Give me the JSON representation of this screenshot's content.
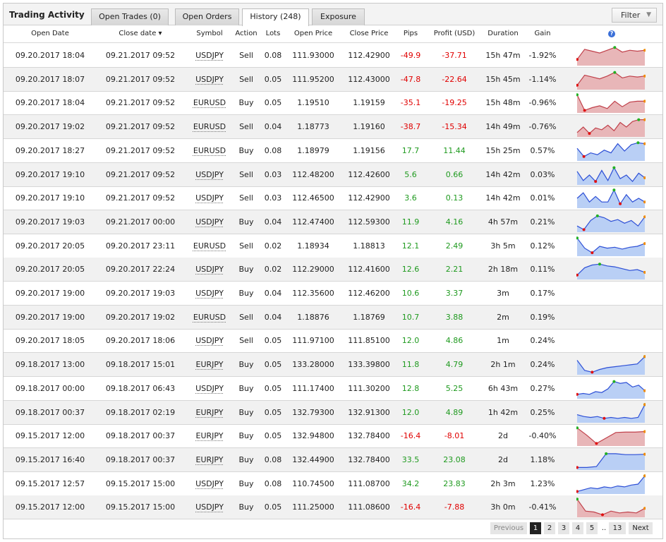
{
  "tabs": {
    "title": "Trading Activity",
    "items": [
      {
        "label": "Open Trades (0)",
        "active": false
      },
      {
        "label": "Open Orders",
        "active": false
      },
      {
        "label": "History (248)",
        "active": true
      },
      {
        "label": "Exposure",
        "active": false
      }
    ],
    "filter_label": "Filter",
    "filter_arrow": "▼"
  },
  "columns": {
    "open_date": "Open Date",
    "close_date": "Close date ▾",
    "symbol": "Symbol",
    "action": "Action",
    "lots": "Lots",
    "open_price": "Open Price",
    "close_price": "Close Price",
    "pips": "Pips",
    "profit": "Profit (USD)",
    "duration": "Duration",
    "gain": "Gain",
    "help": "?"
  },
  "colors": {
    "negative": "#e00000",
    "positive": "#1f9a1f",
    "spark_neg_fill": "#e8b6b8",
    "spark_neg_line": "#c0404a",
    "spark_pos_fill": "#b9cff5",
    "spark_pos_line": "#2d4fd6"
  },
  "rows": [
    {
      "open": "09.20.2017 18:04",
      "close": "09.21.2017 09:52",
      "symbol": "USDJPY",
      "action": "Sell",
      "lots": "0.08",
      "open_price": "111.93000",
      "close_price": "112.42900",
      "pips": "-49.9",
      "profit": "-37.71",
      "duration": "15h 47m",
      "gain": "-1.92%",
      "spark": [
        0.3,
        0.85,
        0.75,
        0.65,
        0.8,
        0.95,
        0.7,
        0.8,
        0.75,
        0.8
      ]
    },
    {
      "open": "09.20.2017 18:07",
      "close": "09.21.2017 09:52",
      "symbol": "USDJPY",
      "action": "Sell",
      "lots": "0.05",
      "open_price": "111.95200",
      "close_price": "112.43000",
      "pips": "-47.8",
      "profit": "-22.64",
      "duration": "15h 45m",
      "gain": "-1.14%",
      "spark": [
        0.2,
        0.75,
        0.65,
        0.55,
        0.7,
        0.9,
        0.6,
        0.7,
        0.65,
        0.7
      ]
    },
    {
      "open": "09.20.2017 18:04",
      "close": "09.21.2017 09:52",
      "symbol": "EURUSD",
      "action": "Buy",
      "lots": "0.05",
      "open_price": "1.19510",
      "close_price": "1.19159",
      "pips": "-35.1",
      "profit": "-19.25",
      "duration": "15h 48m",
      "gain": "-0.96%",
      "spark": [
        0.95,
        0.1,
        0.25,
        0.35,
        0.2,
        0.6,
        0.3,
        0.55,
        0.6,
        0.6
      ]
    },
    {
      "open": "09.20.2017 19:02",
      "close": "09.21.2017 09:52",
      "symbol": "EURUSD",
      "action": "Sell",
      "lots": "0.04",
      "open_price": "1.18773",
      "close_price": "1.19160",
      "pips": "-38.7",
      "profit": "-15.34",
      "duration": "14h 49m",
      "gain": "-0.76%",
      "spark": [
        0.2,
        0.5,
        0.15,
        0.45,
        0.35,
        0.6,
        0.3,
        0.75,
        0.5,
        0.8,
        0.9,
        0.9
      ]
    },
    {
      "open": "09.20.2017 18:27",
      "close": "09.21.2017 09:52",
      "symbol": "EURUSD",
      "action": "Buy",
      "lots": "0.08",
      "open_price": "1.18979",
      "close_price": "1.19156",
      "pips": "17.7",
      "profit": "11.44",
      "duration": "15h 25m",
      "gain": "0.57%",
      "spark": [
        0.65,
        0.2,
        0.4,
        0.3,
        0.55,
        0.4,
        0.9,
        0.5,
        0.85,
        0.95,
        0.9
      ]
    },
    {
      "open": "09.20.2017 19:10",
      "close": "09.21.2017 09:52",
      "symbol": "USDJPY",
      "action": "Sell",
      "lots": "0.03",
      "open_price": "112.48200",
      "close_price": "112.42600",
      "pips": "5.6",
      "profit": "0.66",
      "duration": "14h 42m",
      "gain": "0.03%",
      "spark": [
        0.7,
        0.2,
        0.5,
        0.15,
        0.75,
        0.2,
        0.9,
        0.3,
        0.5,
        0.15,
        0.6,
        0.35
      ]
    },
    {
      "open": "09.20.2017 19:10",
      "close": "09.21.2017 09:52",
      "symbol": "USDJPY",
      "action": "Sell",
      "lots": "0.03",
      "open_price": "112.46500",
      "close_price": "112.42900",
      "pips": "3.6",
      "profit": "0.13",
      "duration": "14h 42m",
      "gain": "0.01%",
      "spark": [
        0.5,
        0.8,
        0.3,
        0.6,
        0.3,
        0.3,
        0.95,
        0.2,
        0.7,
        0.3,
        0.5,
        0.3
      ]
    },
    {
      "open": "09.20.2017 19:03",
      "close": "09.21.2017 00:00",
      "symbol": "USDJPY",
      "action": "Buy",
      "lots": "0.04",
      "open_price": "112.47400",
      "close_price": "112.59300",
      "pips": "11.9",
      "profit": "4.16",
      "duration": "4h 57m",
      "gain": "0.21%",
      "spark": [
        0.3,
        0.1,
        0.6,
        0.85,
        0.75,
        0.55,
        0.65,
        0.45,
        0.6,
        0.3,
        0.8
      ]
    },
    {
      "open": "09.20.2017 20:05",
      "close": "09.20.2017 23:11",
      "symbol": "EURUSD",
      "action": "Sell",
      "lots": "0.02",
      "open_price": "1.18934",
      "close_price": "1.18813",
      "pips": "12.1",
      "profit": "2.49",
      "duration": "3h 5m",
      "gain": "0.12%",
      "spark": [
        0.95,
        0.4,
        0.15,
        0.5,
        0.4,
        0.45,
        0.35,
        0.45,
        0.5,
        0.65
      ]
    },
    {
      "open": "09.20.2017 20:05",
      "close": "09.20.2017 22:24",
      "symbol": "USDJPY",
      "action": "Buy",
      "lots": "0.02",
      "open_price": "112.29000",
      "close_price": "112.41600",
      "pips": "12.6",
      "profit": "2.21",
      "duration": "2h 18m",
      "gain": "0.11%",
      "spark": [
        0.2,
        0.6,
        0.75,
        0.8,
        0.7,
        0.65,
        0.55,
        0.45,
        0.5,
        0.35
      ]
    },
    {
      "open": "09.20.2017 19:00",
      "close": "09.20.2017 19:03",
      "symbol": "USDJPY",
      "action": "Buy",
      "lots": "0.04",
      "open_price": "112.35600",
      "close_price": "112.46200",
      "pips": "10.6",
      "profit": "3.37",
      "duration": "3m",
      "gain": "0.17%",
      "spark": null
    },
    {
      "open": "09.20.2017 19:00",
      "close": "09.20.2017 19:02",
      "symbol": "EURUSD",
      "action": "Sell",
      "lots": "0.04",
      "open_price": "1.18876",
      "close_price": "1.18769",
      "pips": "10.7",
      "profit": "3.88",
      "duration": "2m",
      "gain": "0.19%",
      "spark": null
    },
    {
      "open": "09.20.2017 18:05",
      "close": "09.20.2017 18:06",
      "symbol": "USDJPY",
      "action": "Sell",
      "lots": "0.05",
      "open_price": "111.97100",
      "close_price": "111.85100",
      "pips": "12.0",
      "profit": "4.86",
      "duration": "1m",
      "gain": "0.24%",
      "spark": null
    },
    {
      "open": "09.18.2017 13:00",
      "close": "09.18.2017 15:01",
      "symbol": "EURJPY",
      "action": "Buy",
      "lots": "0.05",
      "open_price": "133.28000",
      "close_price": "133.39800",
      "pips": "11.8",
      "profit": "4.79",
      "duration": "2h 1m",
      "gain": "0.24%",
      "spark": [
        0.75,
        0.2,
        0.1,
        0.25,
        0.35,
        0.4,
        0.45,
        0.5,
        0.55,
        0.95
      ]
    },
    {
      "open": "09.18.2017 00:00",
      "close": "09.18.2017 06:43",
      "symbol": "USDJPY",
      "action": "Buy",
      "lots": "0.05",
      "open_price": "111.17400",
      "close_price": "111.30200",
      "pips": "12.8",
      "profit": "5.25",
      "duration": "6h 43m",
      "gain": "0.27%",
      "spark": [
        0.2,
        0.25,
        0.2,
        0.35,
        0.3,
        0.5,
        0.9,
        0.8,
        0.85,
        0.6,
        0.7,
        0.4
      ]
    },
    {
      "open": "09.18.2017 00:37",
      "close": "09.18.2017 02:19",
      "symbol": "EURJPY",
      "action": "Buy",
      "lots": "0.05",
      "open_price": "132.79300",
      "close_price": "132.91300",
      "pips": "12.0",
      "profit": "4.89",
      "duration": "1h 42m",
      "gain": "0.25%",
      "spark": [
        0.4,
        0.3,
        0.25,
        0.3,
        0.2,
        0.25,
        0.2,
        0.25,
        0.2,
        0.25,
        0.95
      ]
    },
    {
      "open": "09.15.2017 12:00",
      "close": "09.18.2017 00:37",
      "symbol": "EURJPY",
      "action": "Buy",
      "lots": "0.05",
      "open_price": "132.94800",
      "close_price": "132.78400",
      "pips": "-16.4",
      "profit": "-8.01",
      "duration": "2d",
      "gain": "-0.40%",
      "spark": [
        0.95,
        0.55,
        0.1,
        0.4,
        0.7,
        0.72,
        0.72,
        0.75
      ]
    },
    {
      "open": "09.15.2017 16:40",
      "close": "09.18.2017 00:37",
      "symbol": "EURJPY",
      "action": "Buy",
      "lots": "0.08",
      "open_price": "132.44900",
      "close_price": "132.78400",
      "pips": "33.5",
      "profit": "23.08",
      "duration": "2d",
      "gain": "1.18%",
      "spark": [
        0.1,
        0.1,
        0.15,
        0.85,
        0.85,
        0.8,
        0.8,
        0.82
      ]
    },
    {
      "open": "09.15.2017 12:57",
      "close": "09.15.2017 15:00",
      "symbol": "USDJPY",
      "action": "Buy",
      "lots": "0.08",
      "open_price": "110.74500",
      "close_price": "111.08700",
      "pips": "34.2",
      "profit": "23.83",
      "duration": "2h 3m",
      "gain": "1.23%",
      "spark": [
        0.1,
        0.2,
        0.3,
        0.25,
        0.35,
        0.3,
        0.4,
        0.35,
        0.45,
        0.5,
        0.95
      ]
    },
    {
      "open": "09.15.2017 12:00",
      "close": "09.15.2017 15:00",
      "symbol": "USDJPY",
      "action": "Buy",
      "lots": "0.05",
      "open_price": "111.25000",
      "close_price": "111.08600",
      "pips": "-16.4",
      "profit": "-7.88",
      "duration": "3h 0m",
      "gain": "-0.41%",
      "spark": [
        0.95,
        0.3,
        0.25,
        0.1,
        0.3,
        0.2,
        0.25,
        0.2,
        0.45
      ]
    }
  ],
  "pager": {
    "prev": "Previous",
    "pages": [
      "1",
      "2",
      "3",
      "4",
      "5"
    ],
    "ellipsis": "..",
    "last": "13",
    "next": "Next",
    "current": "1"
  }
}
